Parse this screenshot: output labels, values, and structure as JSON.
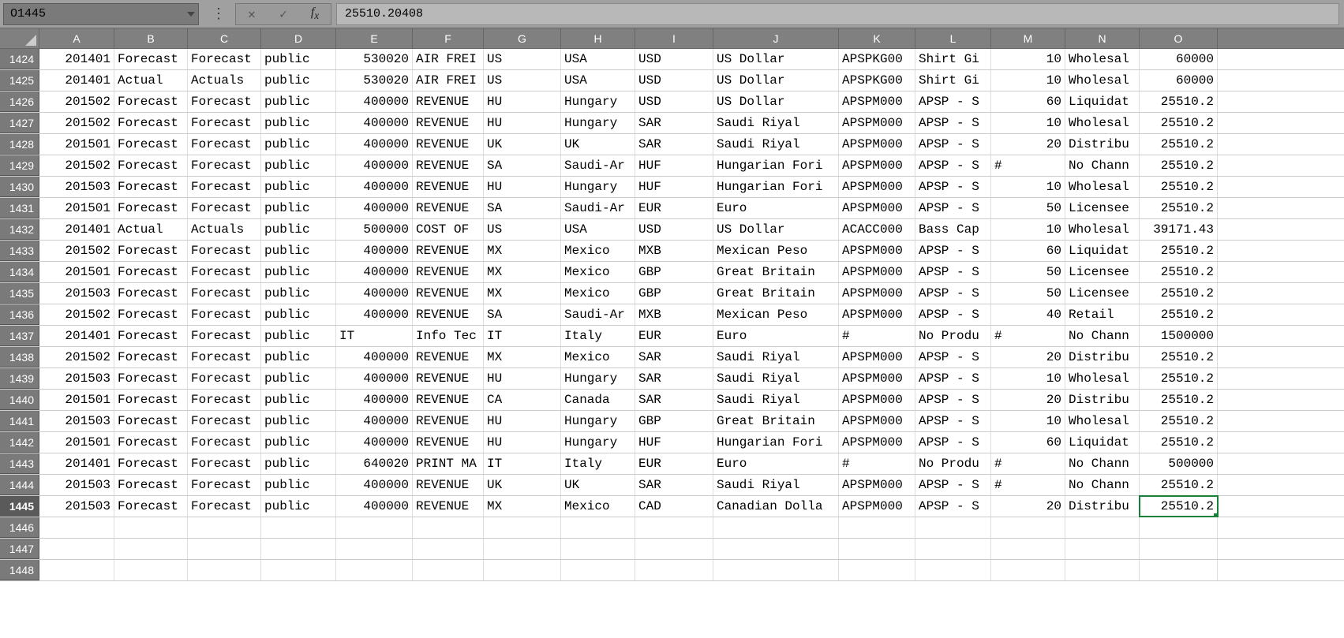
{
  "nameBox": "O1445",
  "formulaValue": "25510.20408",
  "columns": [
    "A",
    "B",
    "C",
    "D",
    "E",
    "F",
    "G",
    "H",
    "I",
    "J",
    "K",
    "L",
    "M",
    "N",
    "O"
  ],
  "colClasses": [
    "cA",
    "cB",
    "cC",
    "cD",
    "cE",
    "cF",
    "cG",
    "cH",
    "cI",
    "cJ",
    "cK",
    "cL",
    "cM",
    "cN",
    "cO"
  ],
  "numericCols": [
    0,
    4,
    12,
    14
  ],
  "selectedRow": 1445,
  "selectedCol": 14,
  "rows": [
    {
      "n": 1424,
      "c": [
        "201401",
        "Forecast",
        "Forecast",
        "public",
        "530020",
        "AIR FREI",
        "US",
        "USA",
        "USD",
        "US Dollar",
        "APSPKG00",
        "Shirt Gi",
        "10",
        "Wholesal",
        "60000"
      ]
    },
    {
      "n": 1425,
      "c": [
        "201401",
        "Actual",
        "Actuals",
        "public",
        "530020",
        "AIR FREI",
        "US",
        "USA",
        "USD",
        "US Dollar",
        "APSPKG00",
        "Shirt Gi",
        "10",
        "Wholesal",
        "60000"
      ]
    },
    {
      "n": 1426,
      "c": [
        "201502",
        "Forecast",
        "Forecast",
        "public",
        "400000",
        "REVENUE",
        "HU",
        "Hungary",
        "USD",
        "US Dollar",
        "APSPM000",
        "APSP - S",
        "60",
        "Liquidat",
        "25510.2"
      ]
    },
    {
      "n": 1427,
      "c": [
        "201502",
        "Forecast",
        "Forecast",
        "public",
        "400000",
        "REVENUE",
        "HU",
        "Hungary",
        "SAR",
        "Saudi Riyal",
        "APSPM000",
        "APSP - S",
        "10",
        "Wholesal",
        "25510.2"
      ]
    },
    {
      "n": 1428,
      "c": [
        "201501",
        "Forecast",
        "Forecast",
        "public",
        "400000",
        "REVENUE",
        "UK",
        "UK",
        "SAR",
        "Saudi Riyal",
        "APSPM000",
        "APSP - S",
        "20",
        "Distribu",
        "25510.2"
      ]
    },
    {
      "n": 1429,
      "c": [
        "201502",
        "Forecast",
        "Forecast",
        "public",
        "400000",
        "REVENUE",
        "SA",
        "Saudi-Ar",
        "HUF",
        "Hungarian Fori",
        "APSPM000",
        "APSP - S",
        "#",
        "No Chann",
        "25510.2"
      ]
    },
    {
      "n": 1430,
      "c": [
        "201503",
        "Forecast",
        "Forecast",
        "public",
        "400000",
        "REVENUE",
        "HU",
        "Hungary",
        "HUF",
        "Hungarian Fori",
        "APSPM000",
        "APSP - S",
        "10",
        "Wholesal",
        "25510.2"
      ]
    },
    {
      "n": 1431,
      "c": [
        "201501",
        "Forecast",
        "Forecast",
        "public",
        "400000",
        "REVENUE",
        "SA",
        "Saudi-Ar",
        "EUR",
        "Euro",
        "APSPM000",
        "APSP - S",
        "50",
        "Licensee",
        "25510.2"
      ]
    },
    {
      "n": 1432,
      "c": [
        "201401",
        "Actual",
        "Actuals",
        "public",
        "500000",
        "COST OF ",
        "US",
        "USA",
        "USD",
        "US Dollar",
        "ACACC000",
        "Bass Cap",
        "10",
        "Wholesal",
        "39171.43"
      ]
    },
    {
      "n": 1433,
      "c": [
        "201502",
        "Forecast",
        "Forecast",
        "public",
        "400000",
        "REVENUE",
        "MX",
        "Mexico",
        "MXB",
        "Mexican Peso",
        "APSPM000",
        "APSP - S",
        "60",
        "Liquidat",
        "25510.2"
      ]
    },
    {
      "n": 1434,
      "c": [
        "201501",
        "Forecast",
        "Forecast",
        "public",
        "400000",
        "REVENUE",
        "MX",
        "Mexico",
        "GBP",
        "Great Britain ",
        "APSPM000",
        "APSP - S",
        "50",
        "Licensee",
        "25510.2"
      ]
    },
    {
      "n": 1435,
      "c": [
        "201503",
        "Forecast",
        "Forecast",
        "public",
        "400000",
        "REVENUE",
        "MX",
        "Mexico",
        "GBP",
        "Great Britain ",
        "APSPM000",
        "APSP - S",
        "50",
        "Licensee",
        "25510.2"
      ]
    },
    {
      "n": 1436,
      "c": [
        "201502",
        "Forecast",
        "Forecast",
        "public",
        "400000",
        "REVENUE",
        "SA",
        "Saudi-Ar",
        "MXB",
        "Mexican Peso",
        "APSPM000",
        "APSP - S",
        "40",
        "Retail",
        "25510.2"
      ]
    },
    {
      "n": 1437,
      "c": [
        "201401",
        "Forecast",
        "Forecast",
        "public",
        "IT",
        "Info Tec",
        "IT",
        "Italy",
        "EUR",
        "Euro",
        "#",
        "No Produ",
        "#",
        "No Chann",
        "1500000"
      ]
    },
    {
      "n": 1438,
      "c": [
        "201502",
        "Forecast",
        "Forecast",
        "public",
        "400000",
        "REVENUE",
        "MX",
        "Mexico",
        "SAR",
        "Saudi Riyal",
        "APSPM000",
        "APSP - S",
        "20",
        "Distribu",
        "25510.2"
      ]
    },
    {
      "n": 1439,
      "c": [
        "201503",
        "Forecast",
        "Forecast",
        "public",
        "400000",
        "REVENUE",
        "HU",
        "Hungary",
        "SAR",
        "Saudi Riyal",
        "APSPM000",
        "APSP - S",
        "10",
        "Wholesal",
        "25510.2"
      ]
    },
    {
      "n": 1440,
      "c": [
        "201501",
        "Forecast",
        "Forecast",
        "public",
        "400000",
        "REVENUE",
        "CA",
        "Canada",
        "SAR",
        "Saudi Riyal",
        "APSPM000",
        "APSP - S",
        "20",
        "Distribu",
        "25510.2"
      ]
    },
    {
      "n": 1441,
      "c": [
        "201503",
        "Forecast",
        "Forecast",
        "public",
        "400000",
        "REVENUE",
        "HU",
        "Hungary",
        "GBP",
        "Great Britain ",
        "APSPM000",
        "APSP - S",
        "10",
        "Wholesal",
        "25510.2"
      ]
    },
    {
      "n": 1442,
      "c": [
        "201501",
        "Forecast",
        "Forecast",
        "public",
        "400000",
        "REVENUE",
        "HU",
        "Hungary",
        "HUF",
        "Hungarian Fori",
        "APSPM000",
        "APSP - S",
        "60",
        "Liquidat",
        "25510.2"
      ]
    },
    {
      "n": 1443,
      "c": [
        "201401",
        "Forecast",
        "Forecast",
        "public",
        "640020",
        "PRINT MA",
        "IT",
        "Italy",
        "EUR",
        "Euro",
        "#",
        "No Produ",
        "#",
        "No Chann",
        "500000"
      ]
    },
    {
      "n": 1444,
      "c": [
        "201503",
        "Forecast",
        "Forecast",
        "public",
        "400000",
        "REVENUE",
        "UK",
        "UK",
        "SAR",
        "Saudi Riyal",
        "APSPM000",
        "APSP - S",
        "#",
        "No Chann",
        "25510.2"
      ]
    },
    {
      "n": 1445,
      "c": [
        "201503",
        "Forecast",
        "Forecast",
        "public",
        "400000",
        "REVENUE",
        "MX",
        "Mexico",
        "CAD",
        "Canadian Dolla",
        "APSPM000",
        "APSP - S",
        "20",
        "Distribu",
        "25510.2"
      ]
    },
    {
      "n": 1446,
      "c": [
        "",
        "",
        "",
        "",
        "",
        "",
        "",
        "",
        "",
        "",
        "",
        "",
        "",
        "",
        ""
      ]
    },
    {
      "n": 1447,
      "c": [
        "",
        "",
        "",
        "",
        "",
        "",
        "",
        "",
        "",
        "",
        "",
        "",
        "",
        "",
        ""
      ]
    },
    {
      "n": 1448,
      "c": [
        "",
        "",
        "",
        "",
        "",
        "",
        "",
        "",
        "",
        "",
        "",
        "",
        "",
        "",
        ""
      ]
    }
  ]
}
